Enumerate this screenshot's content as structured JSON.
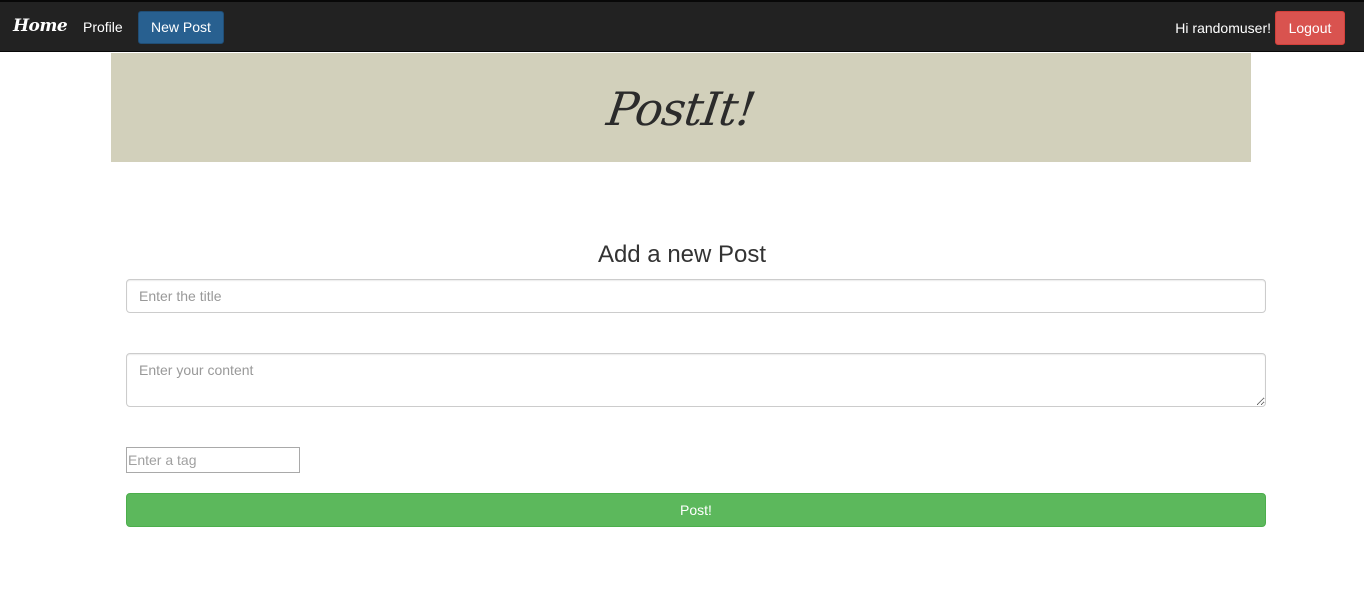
{
  "navbar": {
    "brand": "Home",
    "links": [
      {
        "label": "Profile"
      },
      {
        "label": "New Post",
        "active": true
      }
    ],
    "greeting": "Hi randomuser!",
    "logout_label": "Logout"
  },
  "banner": {
    "title": "PostIt!"
  },
  "form": {
    "heading": "Add a new Post",
    "title_placeholder": "Enter the title",
    "title_value": "",
    "content_placeholder": "Enter your content",
    "content_value": "",
    "tag_placeholder": "Enter a tag",
    "tag_value": "",
    "submit_label": "Post!"
  },
  "colors": {
    "navbar_bg": "#222222",
    "active_link": "#286090",
    "logout": "#d9534f",
    "banner_bg": "#d2d0bb",
    "submit": "#5cb85c"
  }
}
